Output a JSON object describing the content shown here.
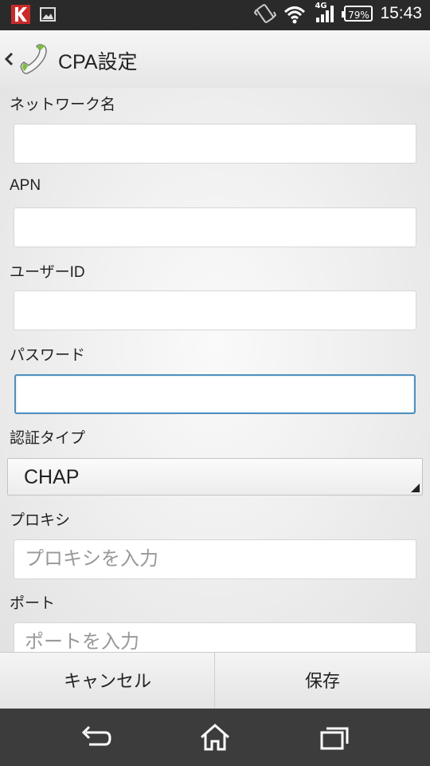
{
  "status_bar": {
    "network_type": "4G",
    "battery_percent": "79%",
    "time": "15:43",
    "icons": [
      "kaspersky-icon",
      "image-notification-icon",
      "vibrate-icon",
      "wifi-icon",
      "signal-icon",
      "battery-icon"
    ]
  },
  "action_bar": {
    "title": "CPA設定",
    "app_icon": "phone-handset-icon"
  },
  "form": {
    "network_name": {
      "label": "ネットワーク名",
      "value": "",
      "placeholder": ""
    },
    "apn": {
      "label": "APN",
      "value": "",
      "placeholder": ""
    },
    "user_id": {
      "label": "ユーザーID",
      "value": "",
      "placeholder": ""
    },
    "password": {
      "label": "パスワード",
      "value": "",
      "placeholder": ""
    },
    "auth_type": {
      "label": "認証タイプ",
      "value": "CHAP"
    },
    "proxy": {
      "label": "プロキシ",
      "value": "",
      "placeholder": "プロキシを入力"
    },
    "port": {
      "label": "ポート",
      "value": "",
      "placeholder": "ポートを入力"
    }
  },
  "buttons": {
    "cancel": "キャンセル",
    "save": "保存"
  },
  "colors": {
    "focus_border": "#4f8fbf",
    "status_bar": "#2a2a2a",
    "nav_bar": "#3c3c3c"
  }
}
